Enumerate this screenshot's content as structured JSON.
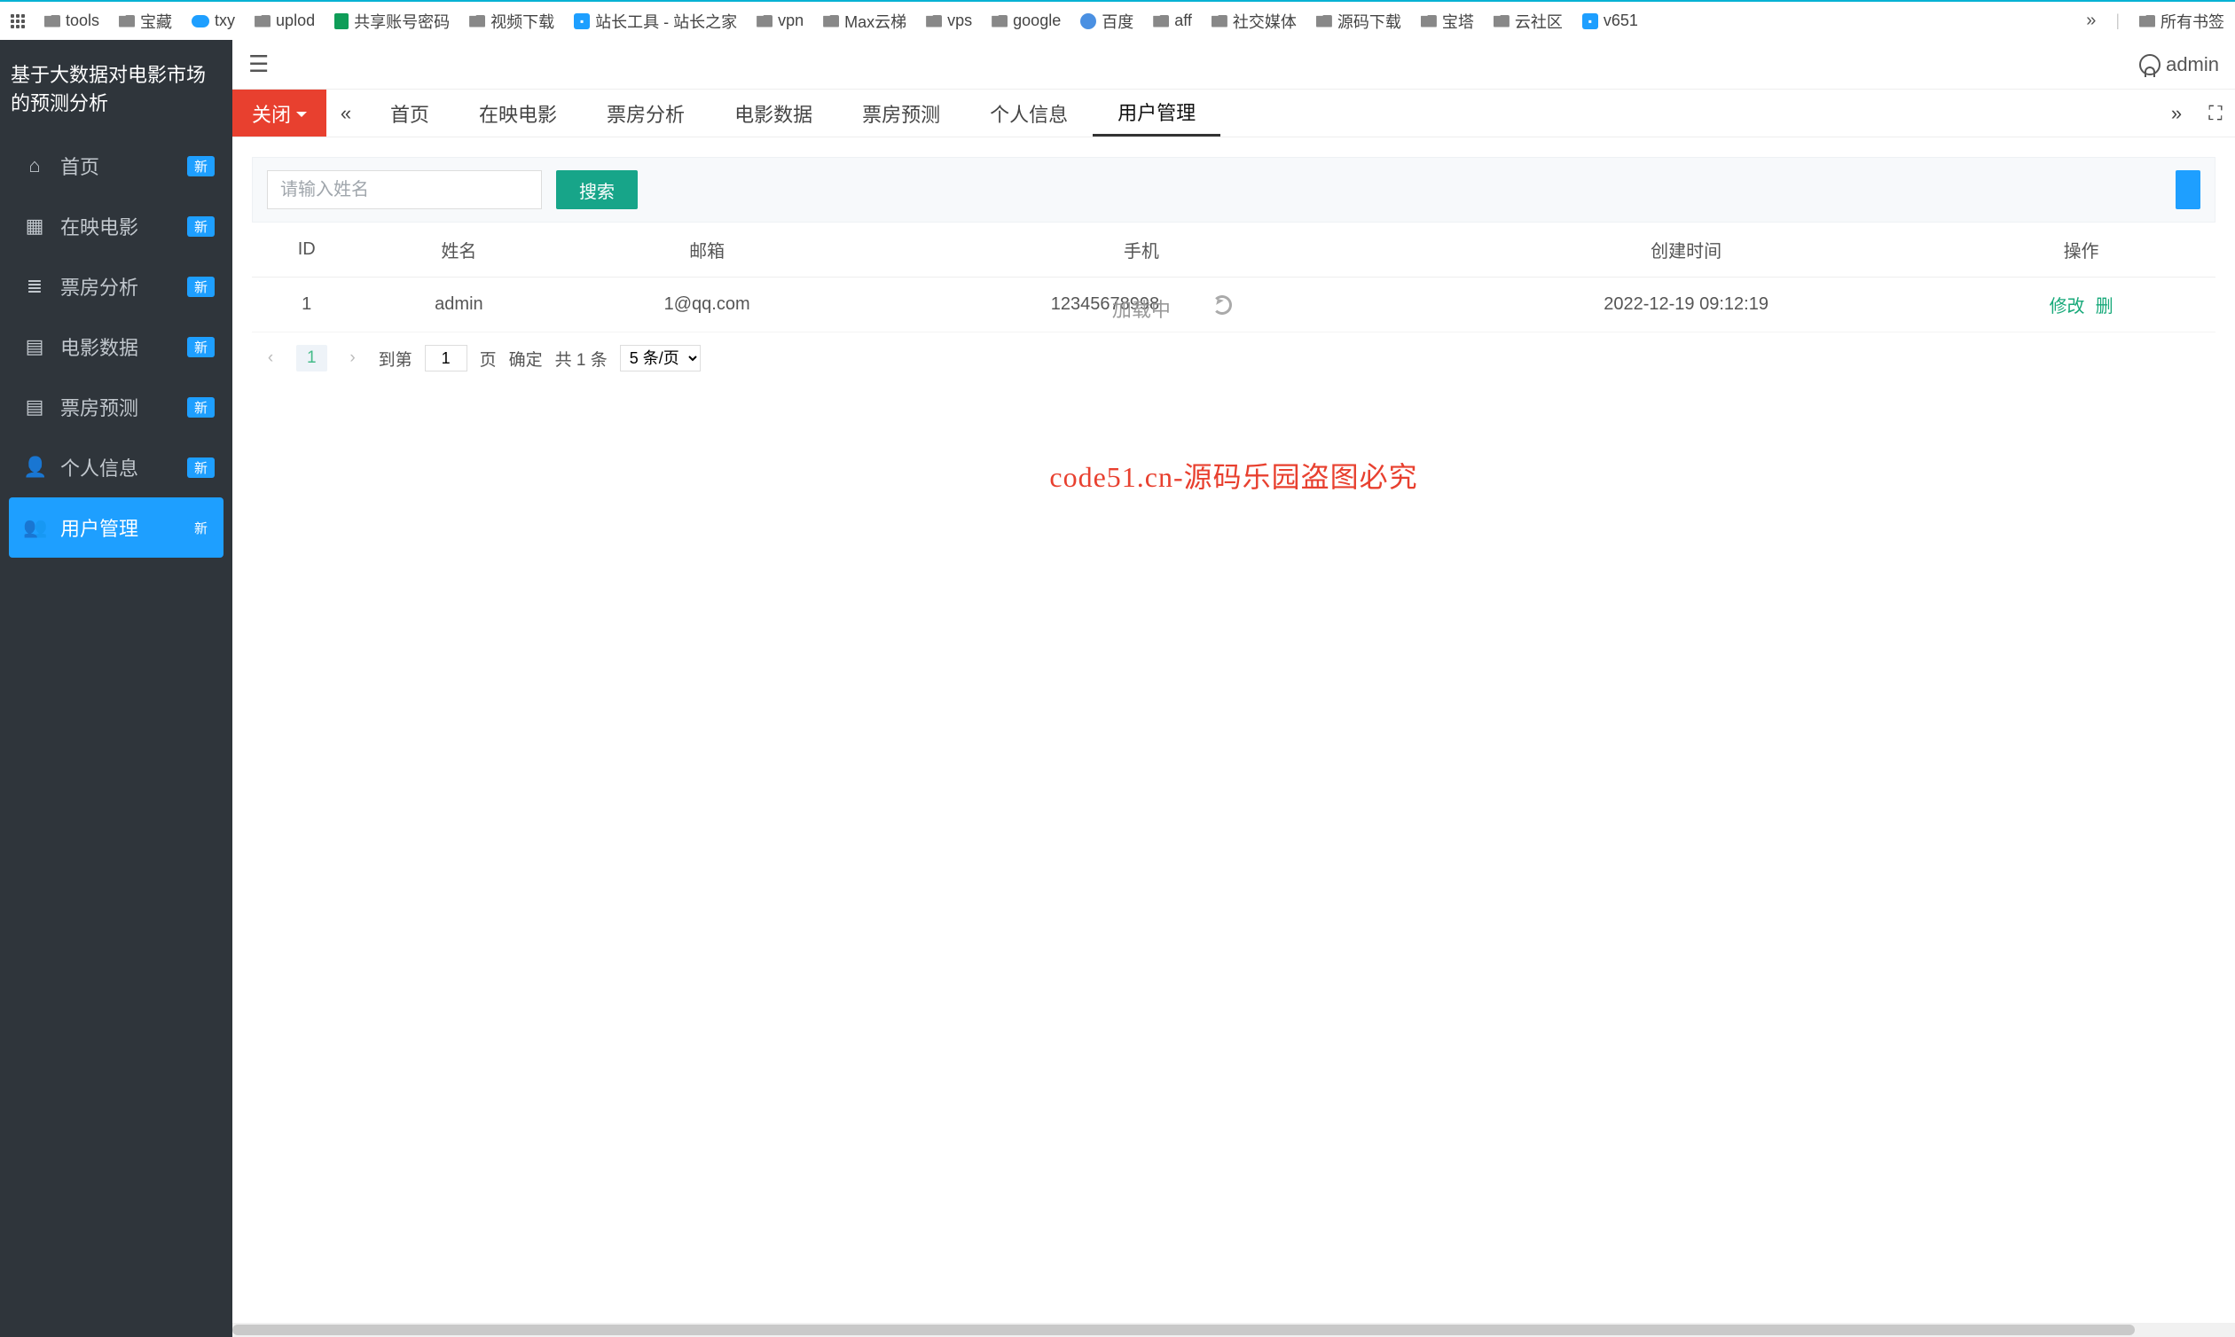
{
  "bookmarks": {
    "items": [
      {
        "label": "tools",
        "icon": "folder"
      },
      {
        "label": "宝藏",
        "icon": "folder"
      },
      {
        "label": "txy",
        "icon": "cloud"
      },
      {
        "label": "uplod",
        "icon": "folder"
      },
      {
        "label": "共享账号密码",
        "icon": "doc"
      },
      {
        "label": "视频下载",
        "icon": "folder"
      },
      {
        "label": "站长工具 - 站长之家",
        "icon": "box"
      },
      {
        "label": "vpn",
        "icon": "folder"
      },
      {
        "label": "Max云梯",
        "icon": "folder"
      },
      {
        "label": "vps",
        "icon": "folder"
      },
      {
        "label": "google",
        "icon": "folder"
      },
      {
        "label": "百度",
        "icon": "paw"
      },
      {
        "label": "aff",
        "icon": "folder"
      },
      {
        "label": "社交媒体",
        "icon": "folder"
      },
      {
        "label": "源码下载",
        "icon": "folder"
      },
      {
        "label": "宝塔",
        "icon": "folder"
      },
      {
        "label": "云社区",
        "icon": "folder"
      },
      {
        "label": "v651",
        "icon": "box"
      }
    ],
    "overflow": "»",
    "all_label": "所有书签"
  },
  "sidebar": {
    "title": "基于大数据对电影市场的预测分析",
    "items": [
      {
        "icon": "⌂",
        "label": "首页",
        "badge": "新"
      },
      {
        "icon": "▦",
        "label": "在映电影",
        "badge": "新"
      },
      {
        "icon": "≣",
        "label": "票房分析",
        "badge": "新"
      },
      {
        "icon": "▤",
        "label": "电影数据",
        "badge": "新"
      },
      {
        "icon": "▤",
        "label": "票房预测",
        "badge": "新"
      },
      {
        "icon": "👤",
        "label": "个人信息",
        "badge": "新"
      },
      {
        "icon": "👥",
        "label": "用户管理",
        "badge": "新"
      }
    ],
    "active_index": 6
  },
  "header": {
    "username": "admin"
  },
  "tabs": {
    "close_label": "关闭",
    "items": [
      "首页",
      "在映电影",
      "票房分析",
      "电影数据",
      "票房预测",
      "个人信息",
      "用户管理"
    ],
    "active_index": 6
  },
  "search": {
    "placeholder": "请输入姓名",
    "button": "搜索"
  },
  "table": {
    "columns": [
      "ID",
      "姓名",
      "邮箱",
      "手机",
      "创建时间",
      "操作"
    ],
    "loading_text": "加载中",
    "rows": [
      {
        "id": "1",
        "name": "admin",
        "email": "1@qq.com",
        "phone": "12345678998",
        "created": "2022-12-19 09:12:19",
        "op_edit": "修改",
        "op_del": "删"
      }
    ]
  },
  "pagination": {
    "current": "1",
    "goto_prefix": "到第",
    "goto_value": "1",
    "goto_suffix": "页",
    "confirm": "确定",
    "total": "共 1 条",
    "page_size": "5 条/页"
  },
  "watermark_text": "code51.cn",
  "banner": "code51.cn-源码乐园盗图必究"
}
